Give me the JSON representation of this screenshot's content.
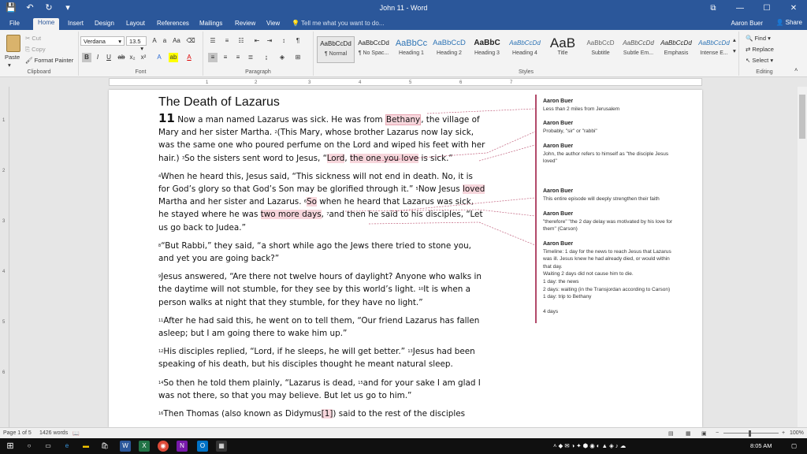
{
  "window": {
    "title": "John 11 - Word",
    "qat": [
      "💾",
      "↶",
      "↻",
      "▾"
    ],
    "controls": [
      "⧉",
      "—",
      "☐",
      "✕"
    ]
  },
  "tabs": [
    "File",
    "Home",
    "Insert",
    "Design",
    "Layout",
    "References",
    "Mailings",
    "Review",
    "View"
  ],
  "tell_me": "Tell me what you want to do...",
  "user_name": "Aaron Buer",
  "share_label": "Share",
  "ribbon": {
    "clipboard": {
      "paste": "Paste",
      "cut": "Cut",
      "copy": "Copy",
      "format_painter": "Format Painter",
      "label": "Clipboard"
    },
    "font": {
      "name": "Verdana",
      "size": "13.5",
      "label": "Font"
    },
    "paragraph": {
      "label": "Paragraph"
    },
    "styles": {
      "label": "Styles",
      "items": [
        {
          "sample": "AaBbCcDd",
          "name": "¶ Normal"
        },
        {
          "sample": "AaBbCcDd",
          "name": "¶ No Spac..."
        },
        {
          "sample": "AaBbCc",
          "name": "Heading 1"
        },
        {
          "sample": "AaBbCcD",
          "name": "Heading 2"
        },
        {
          "sample": "AaBbC",
          "name": "Heading 3"
        },
        {
          "sample": "AaBbCcDd",
          "name": "Heading 4"
        },
        {
          "sample": "AaB",
          "name": "Title"
        },
        {
          "sample": "AaBbCcD",
          "name": "Subtitle"
        },
        {
          "sample": "AaBbCcDd",
          "name": "Subtle Em..."
        },
        {
          "sample": "AaBbCcDd",
          "name": "Emphasis"
        },
        {
          "sample": "AaBbCcDd",
          "name": "Intense E..."
        }
      ]
    },
    "editing": {
      "find": "Find",
      "replace": "Replace",
      "select": "Select",
      "label": "Editing"
    }
  },
  "ruler_numbers": [
    "1",
    "2",
    "3",
    "4",
    "5",
    "6",
    "7"
  ],
  "vruler_numbers": [
    "1",
    "2",
    "3",
    "4",
    "5",
    "6"
  ],
  "document": {
    "title": "The Death of Lazarus",
    "chapter": "11",
    "p1": {
      "a": "Now a man named Lazarus was sick. He was from ",
      "h1": "Bethany",
      "b": ", the village of Mary and her sister Martha. ",
      "v2": "2",
      "c": "(This Mary, whose brother Lazarus now lay sick, was the same one who poured perfume on the Lord and wiped his feet with her hair.) ",
      "v3": "3",
      "d": "So the sisters sent word to Jesus, “",
      "h2": "Lord",
      "e": ", ",
      "h3": "the one you love",
      "f": " is sick.”"
    },
    "p2": {
      "v4": "4",
      "a": "When he heard this, Jesus said, “This sickness will not end in death. No, it is for God’s glory so that God’s Son may be glorified through it.” ",
      "v5": "5",
      "b": "Now Jesus ",
      "h1": "loved",
      "c": " Martha and her sister and Lazarus. ",
      "v6": "6",
      "h2": "So",
      "d": " when he heard that Lazarus was sick, he stayed where he was ",
      "h3": "two more days",
      "e": ", ",
      "v7": "7",
      "f": "and then he said to his disciples, “Let us go back to Judea.”"
    },
    "p3": {
      "v": "8",
      "t": "“But Rabbi,” they said, “a short while ago the Jews there tried to stone you, and yet you are going back?”"
    },
    "p4": {
      "v": "9",
      "t": "Jesus answered, “Are there not twelve hours of daylight? Anyone who walks in the daytime will not stumble, for they see by this world’s light. ",
      "v2": "10",
      "t2": "It is when a person walks at night that they stumble, for they have no light.”"
    },
    "p5": {
      "v": "11",
      "t": "After he had said this, he went on to tell them, “Our friend Lazarus has fallen asleep; but I am going there to wake him up.”"
    },
    "p6": {
      "v": "12",
      "t": "His disciples replied, “Lord, if he sleeps, he will get better.” ",
      "v2": "13",
      "t2": "Jesus had been speaking of his death, but his disciples thought he meant natural sleep."
    },
    "p7": {
      "v": "14",
      "t": "So then he told them plainly, “Lazarus is dead, ",
      "v2": "15",
      "t2": "and for your sake I am glad I was not there, so that you may believe. But let us go to him.”"
    },
    "p8": {
      "v": "16",
      "t": "Then Thomas (also known as Didymus",
      "t2": ") said to the rest of the disciples"
    }
  },
  "comments": [
    {
      "author": "Aaron Buer",
      "lines": [
        "Less than 2 miles from Jerusalem"
      ]
    },
    {
      "author": "Aaron Buer",
      "lines": [
        "Probably, \"sir\" or \"rabbi\""
      ]
    },
    {
      "author": "Aaron Buer",
      "lines": [
        "John, the author refers to himself as \"the disciple Jesus",
        "loved\""
      ]
    },
    {
      "author": "Aaron Buer",
      "lines": [
        "This entire episode will deeply strengthen their faith"
      ]
    },
    {
      "author": "Aaron Buer",
      "lines": [
        "\"therefore\" \"the 2 day delay was motivated by his love for",
        "them\" (Carson)"
      ]
    },
    {
      "author": "Aaron Buer",
      "lines": [
        "Timeline:  1 day for the news to reach Jesus that Lazarus",
        "was ill.  Jesus knew he had already died, or would within",
        "that day.",
        "Waiting 2 days did not cause him to die.",
        "1 day:  the news",
        "2 days:  waiting (in the Transjordan according to Carson)",
        "1 day:  trip to Bethany",
        "",
        "4 days"
      ]
    }
  ],
  "status": {
    "page": "Page 1 of 5",
    "words": "1426 words",
    "zoom": "100%"
  },
  "taskbar": {
    "time": "8:05 AM"
  },
  "colors": {
    "word_blue": "#2b579a",
    "highlight": "#f7d6dc",
    "comment_border": "#b24a6a"
  }
}
